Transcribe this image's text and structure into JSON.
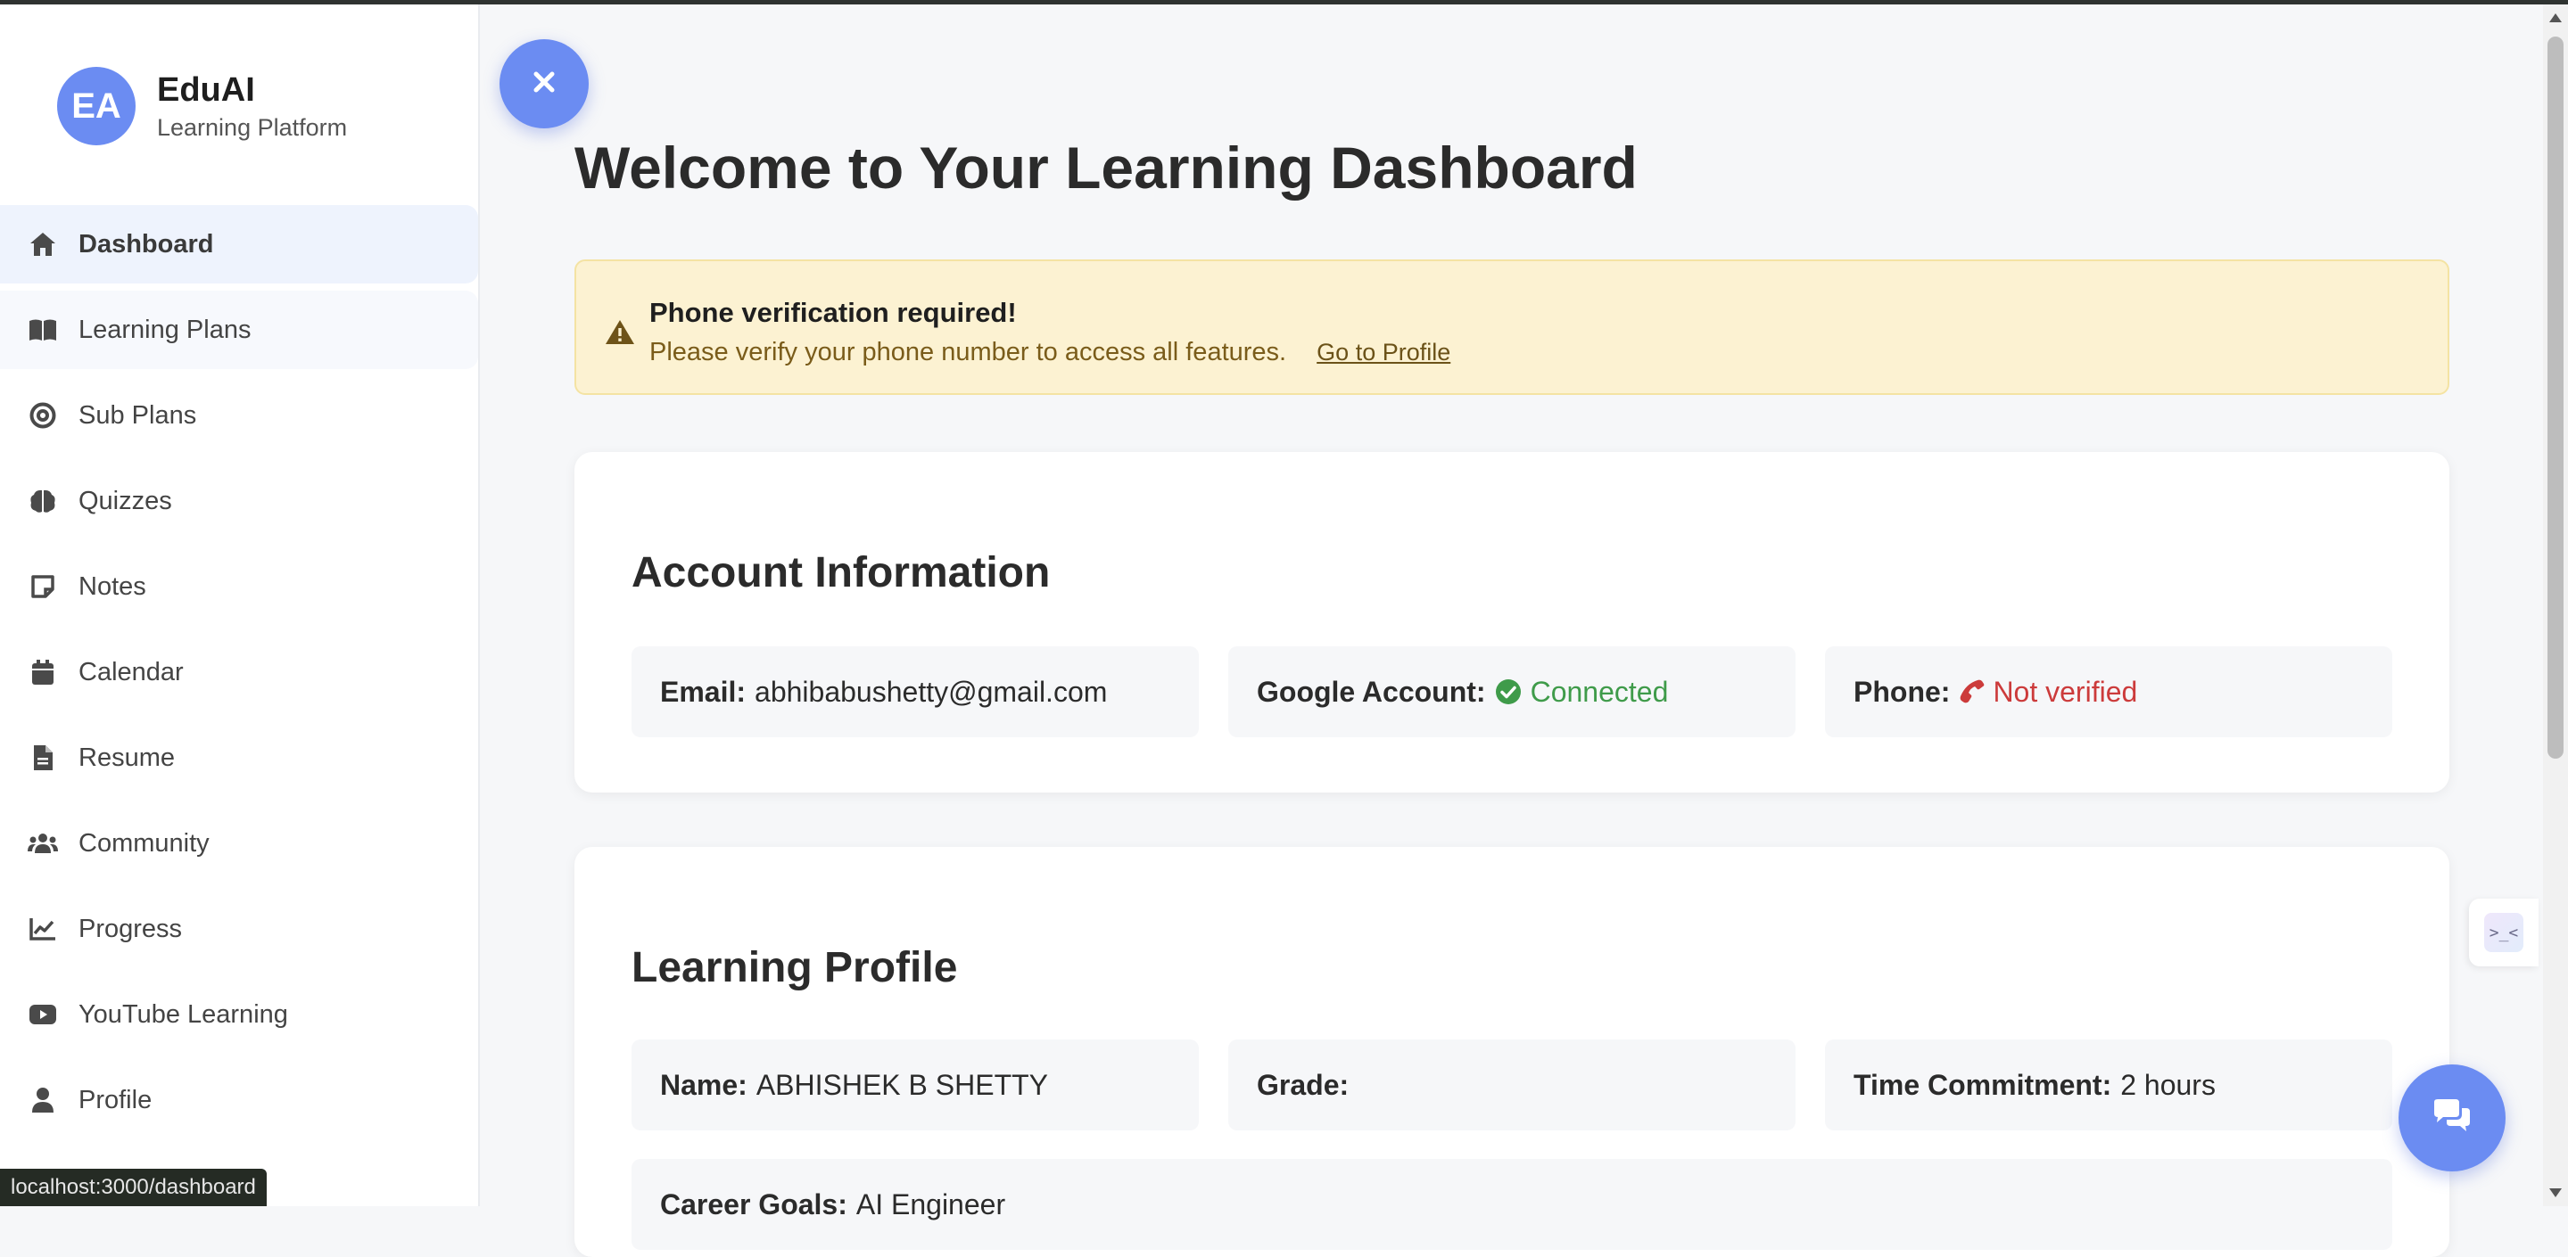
{
  "brand": {
    "initials": "EA",
    "name": "EduAI",
    "subtitle": "Learning Platform"
  },
  "sidebar": {
    "items": [
      {
        "label": "Dashboard",
        "icon": "home-icon",
        "active": true
      },
      {
        "label": "Learning Plans",
        "icon": "book-open-icon"
      },
      {
        "label": "Sub Plans",
        "icon": "target-icon"
      },
      {
        "label": "Quizzes",
        "icon": "brain-icon"
      },
      {
        "label": "Notes",
        "icon": "sticky-note-icon"
      },
      {
        "label": "Calendar",
        "icon": "calendar-icon"
      },
      {
        "label": "Resume",
        "icon": "file-icon"
      },
      {
        "label": "Community",
        "icon": "users-icon"
      },
      {
        "label": "Progress",
        "icon": "chart-line-icon"
      },
      {
        "label": "YouTube Learning",
        "icon": "youtube-icon"
      },
      {
        "label": "Profile",
        "icon": "user-icon"
      }
    ]
  },
  "status_url": "localhost:3000/dashboard",
  "main": {
    "title": "Welcome to Your Learning Dashboard",
    "alert": {
      "title": "Phone verification required!",
      "body": "Please verify your phone number to access all features.",
      "link": "Go to Profile"
    },
    "account": {
      "title": "Account Information",
      "email_label": "Email:",
      "email_value": "abhibabushetty@gmail.com",
      "google_label": "Google Account:",
      "google_value": "Connected",
      "phone_label": "Phone:",
      "phone_value": "Not verified"
    },
    "learning": {
      "title": "Learning Profile",
      "name_label": "Name:",
      "name_value": "ABHISHEK B SHETTY",
      "grade_label": "Grade:",
      "grade_value": "",
      "time_label": "Time Commitment:",
      "time_value": "2 hours",
      "career_label": "Career Goals:",
      "career_value": "AI Engineer"
    }
  },
  "colors": {
    "accent": "#6b8cf2",
    "success": "#3f9b4a",
    "danger": "#cc3b3b",
    "alert_bg": "#fcf2d2"
  }
}
